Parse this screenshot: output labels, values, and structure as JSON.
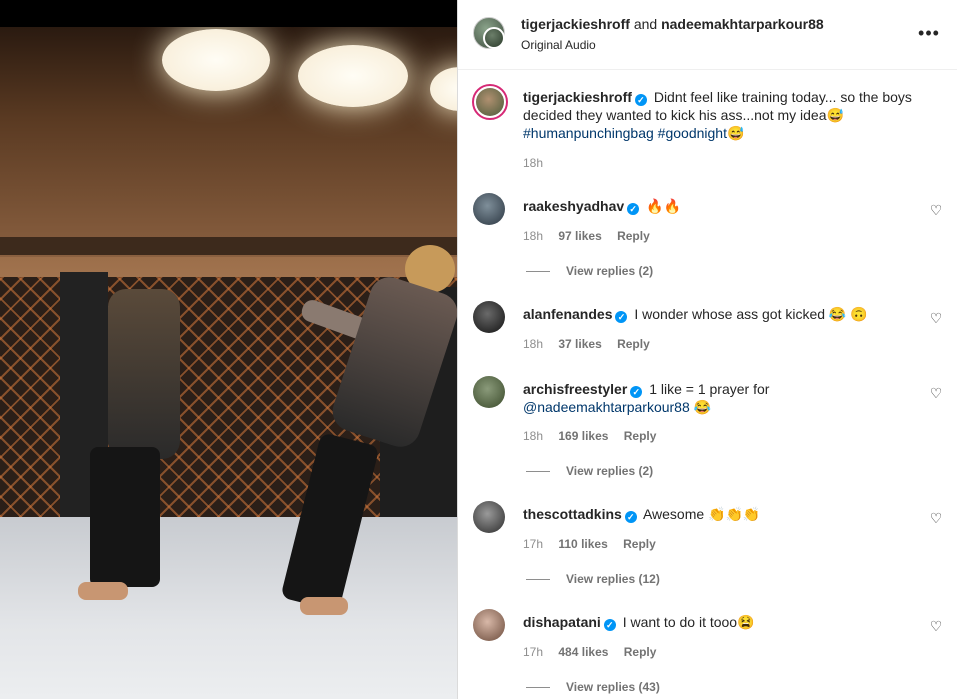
{
  "post": {
    "header": {
      "author": "tigerjackieshroff",
      "connector": "and",
      "collaborator": "nadeemakhtarparkour88",
      "audio": "Original Audio",
      "more_icon": "ellipsis-icon"
    },
    "caption": {
      "author": "tigerjackieshroff",
      "text": "Didnt feel like training today... so the boys decided they wanted to kick his ass...not my idea😅",
      "hashtag1": "#humanpunchingbag",
      "hashtag2": "#goodnight😅",
      "time": "18h"
    },
    "comments": [
      {
        "user": "raakeshyadhav",
        "text": "🔥🔥",
        "time": "18h",
        "likes": "97 likes",
        "reply": "Reply",
        "view_replies": "View replies (2)",
        "avatar_color": "#3a4a55"
      },
      {
        "user": "alanfenandes",
        "text": "I wonder whose ass got kicked 😂 🙃",
        "time": "18h",
        "likes": "37 likes",
        "reply": "Reply",
        "view_replies": "",
        "avatar_color": "#2b2b2b"
      },
      {
        "user": "archisfreestyler",
        "text": "1 like = 1 prayer for",
        "mention": "@nadeemakhtarparkour88 😂",
        "time": "18h",
        "likes": "169 likes",
        "reply": "Reply",
        "view_replies": "View replies (2)",
        "avatar_color": "#6a7a5a"
      },
      {
        "user": "thescottadkins",
        "text": "Awesome 👏👏👏",
        "time": "17h",
        "likes": "110 likes",
        "reply": "Reply",
        "view_replies": "View replies (12)",
        "avatar_color": "#4a4a4a"
      },
      {
        "user": "dishapatani",
        "text": "I want to do it tooo😫",
        "time": "17h",
        "likes": "484 likes",
        "reply": "Reply",
        "view_replies": "View replies (43)",
        "avatar_color": "#b08a7a"
      }
    ]
  },
  "icons": {
    "heart": "heart-icon",
    "verified": "verified-badge-icon"
  }
}
